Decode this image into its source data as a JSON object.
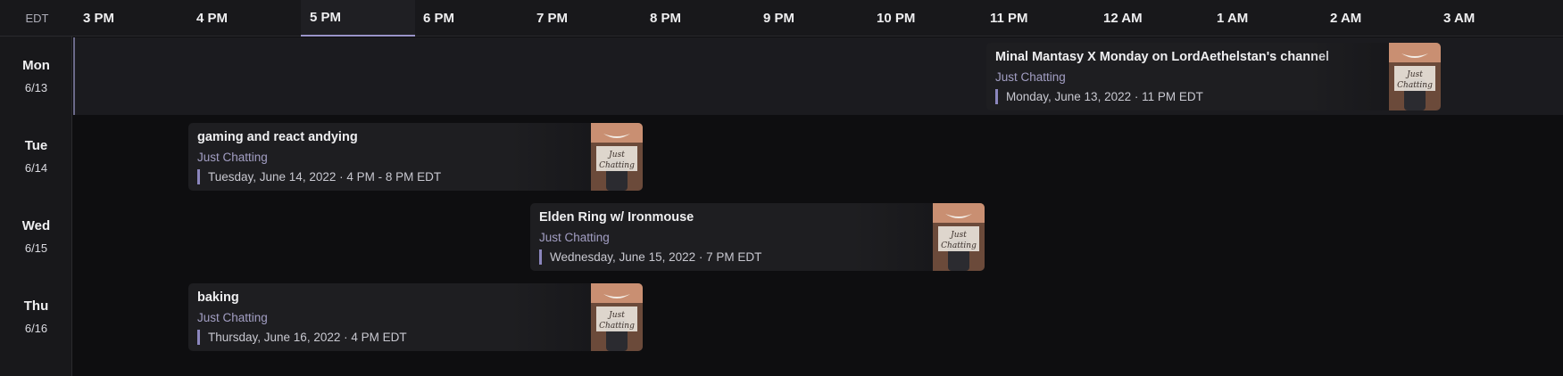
{
  "header": {
    "timezone": "EDT",
    "hours": [
      "3 PM",
      "4 PM",
      "5 PM",
      "6 PM",
      "7 PM",
      "8 PM",
      "9 PM",
      "10 PM",
      "11 PM",
      "12 AM",
      "1 AM",
      "2 AM",
      "3 AM"
    ],
    "active_hour": "5 PM"
  },
  "days": [
    {
      "name": "Mon",
      "date": "6/13"
    },
    {
      "name": "Tue",
      "date": "6/14"
    },
    {
      "name": "Wed",
      "date": "6/15"
    },
    {
      "name": "Thu",
      "date": "6/16"
    }
  ],
  "events": [
    {
      "title": "Minal Mantasy X Monday on LordAethelstan's channel",
      "category": "Just Chatting",
      "time": "Monday, June 13, 2022 · 11 PM EDT",
      "thumb_text": "Just Chatting"
    },
    {
      "title": "gaming and react andying",
      "category": "Just Chatting",
      "time": "Tuesday, June 14, 2022 · 4 PM - 8 PM EDT",
      "thumb_text": "Just Chatting"
    },
    {
      "title": "Elden Ring w/ Ironmouse",
      "category": "Just Chatting",
      "time": "Wednesday, June 15, 2022 · 7 PM EDT",
      "thumb_text": "Just Chatting"
    },
    {
      "title": "baking",
      "category": "Just Chatting",
      "time": "Thursday, June 16, 2022 · 4 PM EDT",
      "thumb_text": "Just Chatting"
    }
  ],
  "colors": {
    "background": "#0e0e10",
    "panel": "#18181b",
    "card": "#1e1e21",
    "accent": "#8b86bd",
    "category_text": "#a39fc4"
  }
}
